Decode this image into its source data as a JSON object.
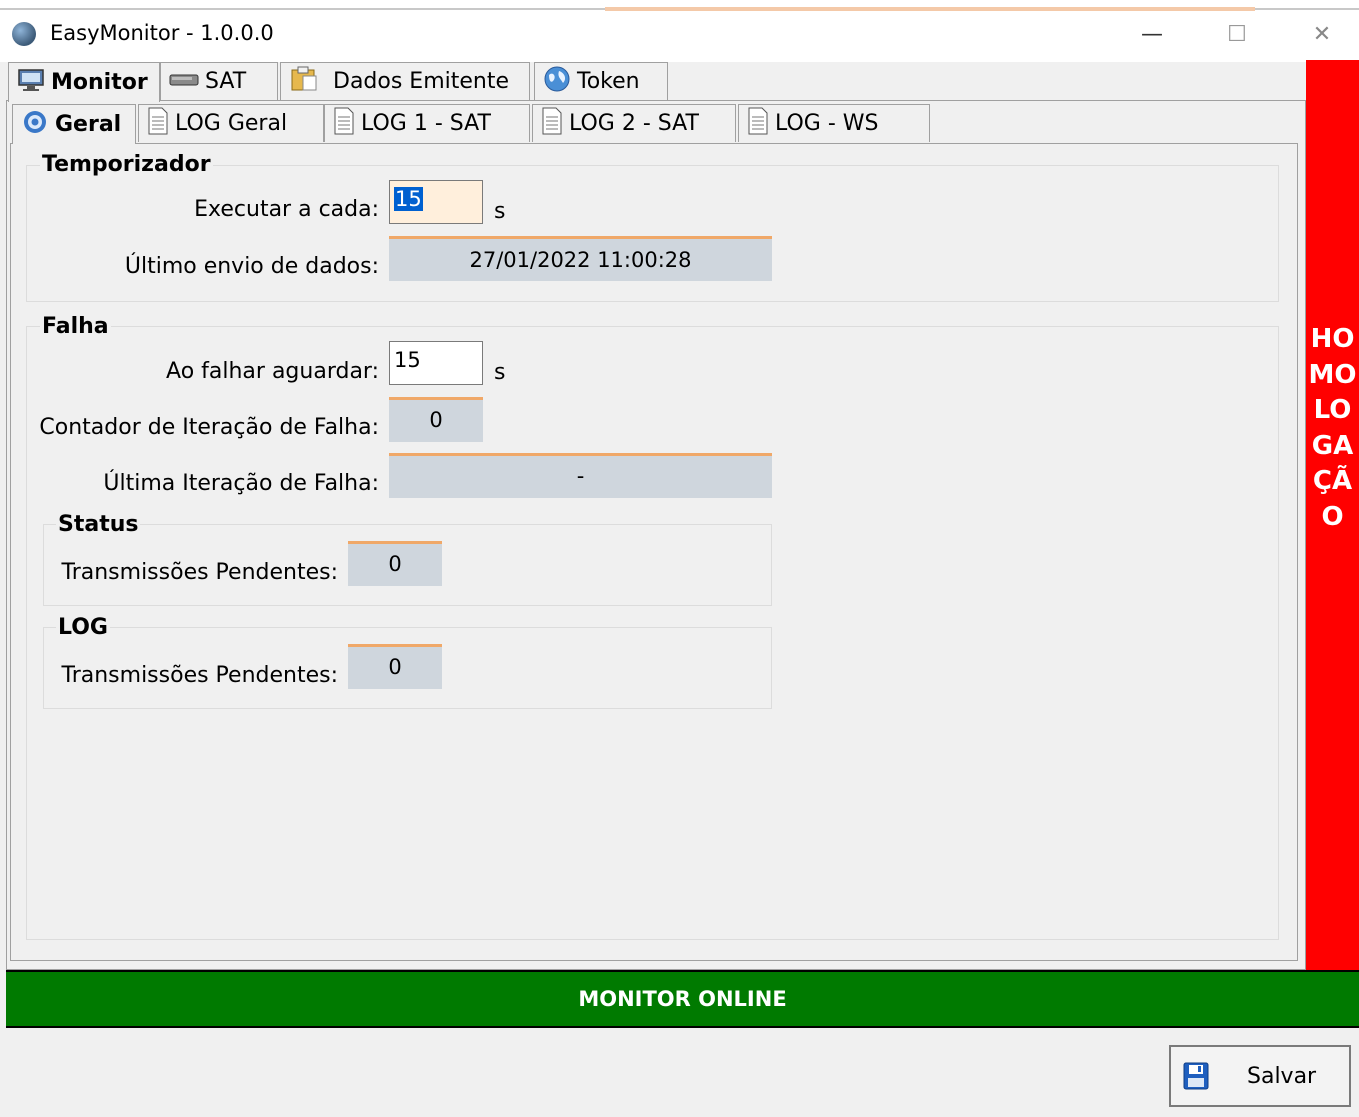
{
  "window": {
    "title": "EasyMonitor - 1.0.0.0",
    "min_glyph": "—",
    "max_glyph": "☐",
    "close_glyph": "✕"
  },
  "outer_tabs": [
    {
      "label": "Monitor",
      "icon": "monitor-icon",
      "active": true
    },
    {
      "label": "SAT",
      "icon": "drive-icon"
    },
    {
      "label": "Dados Emitente",
      "icon": "clipboard-icon"
    },
    {
      "label": "Token",
      "icon": "globe-icon"
    }
  ],
  "inner_tabs": [
    {
      "label": "Geral",
      "icon": "gear-icon",
      "active": true
    },
    {
      "label": "LOG Geral",
      "icon": "document-icon"
    },
    {
      "label": "LOG 1 - SAT",
      "icon": "document-icon"
    },
    {
      "label": "LOG 2 - SAT",
      "icon": "document-icon"
    },
    {
      "label": "LOG - WS",
      "icon": "document-icon"
    }
  ],
  "temporizador": {
    "title": "Temporizador",
    "executar_label": "Executar a cada:",
    "executar_value": "15",
    "executar_unit": "s",
    "ultimo_envio_label": "Último envio de dados:",
    "ultimo_envio_value": "27/01/2022 11:00:28"
  },
  "falha": {
    "title": "Falha",
    "aguardar_label": "Ao falhar aguardar:",
    "aguardar_value": "15",
    "aguardar_unit": "s",
    "contador_label": "Contador de Iteração de Falha:",
    "contador_value": "0",
    "ultima_label": "Última Iteração de Falha:",
    "ultima_value": "-"
  },
  "status": {
    "title": "Status",
    "pendentes_label": "Transmissões Pendentes:",
    "pendentes_value": "0"
  },
  "log": {
    "title": "LOG",
    "pendentes_label": "Transmissões Pendentes:",
    "pendentes_value": "0"
  },
  "environment_banner": "HOMOLOGAÇÃO",
  "status_bar": "MONITOR ONLINE",
  "save_label": "Salvar",
  "colors": {
    "banner_red": "#ff0000",
    "status_green": "#007a00",
    "readonly_fill": "#cfd6dd",
    "readonly_accent": "#f0a868",
    "selected_input_fill": "#ffefdc"
  }
}
